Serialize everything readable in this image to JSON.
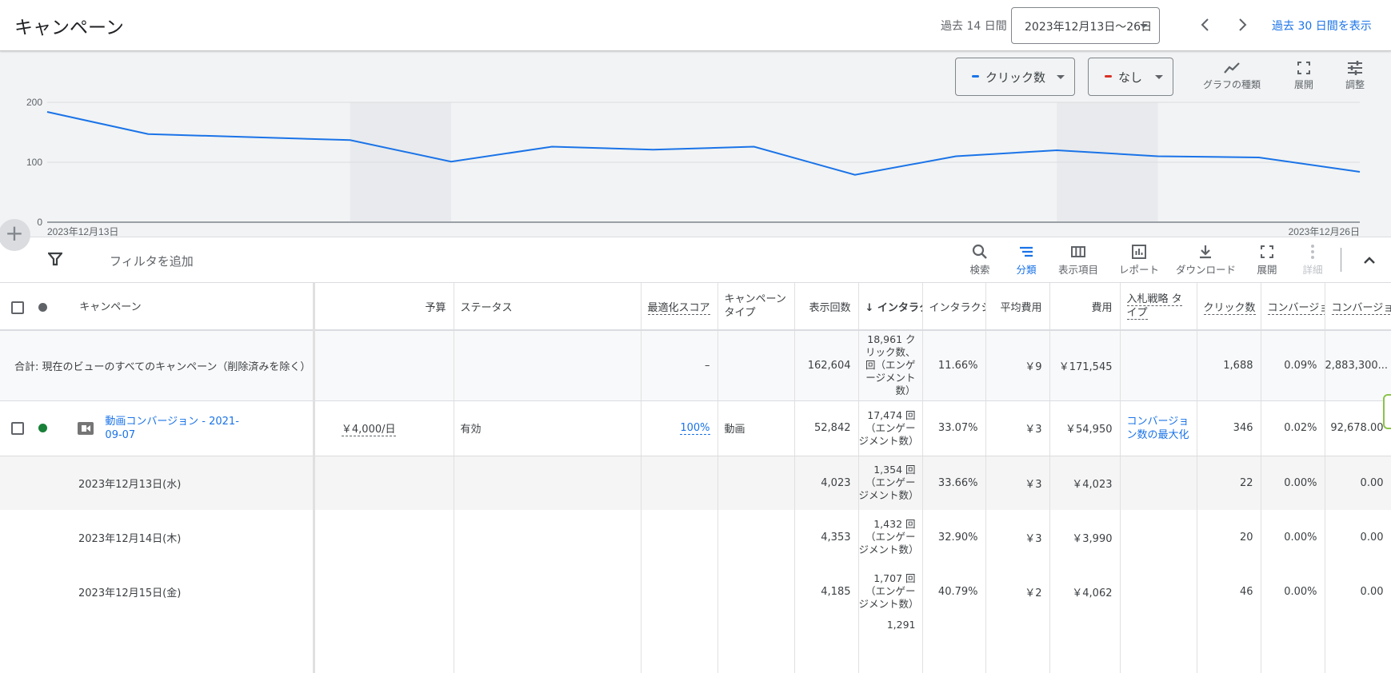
{
  "header": {
    "title": "キャンペーン",
    "range_label": "過去 14 日間",
    "date_range": "2023年12月13日～26日",
    "prev_label": "‹",
    "next_label": "›",
    "show_30_days": "過去 30 日間を表示"
  },
  "chart_controls": {
    "metric1": {
      "label": "クリック数",
      "color": "#1a73e8"
    },
    "metric2": {
      "label": "なし",
      "color": "#d93025"
    },
    "chart_type": "グラフの種類",
    "expand": "展開",
    "adjust": "調整"
  },
  "chart_data": {
    "type": "line",
    "title": "",
    "xlabel": "",
    "ylabel": "",
    "ylim": [
      0,
      200
    ],
    "yticks": [
      "0",
      "100",
      "200"
    ],
    "x_start_label": "2023年12月13日",
    "x_end_label": "2023年12月26日",
    "x": [
      "2023-12-13",
      "2023-12-14",
      "2023-12-15",
      "2023-12-16",
      "2023-12-17",
      "2023-12-18",
      "2023-12-19",
      "2023-12-20",
      "2023-12-21",
      "2023-12-22",
      "2023-12-23",
      "2023-12-24",
      "2023-12-25",
      "2023-12-26"
    ],
    "series": [
      {
        "name": "クリック数",
        "color": "#1a73e8",
        "values": [
          184,
          147,
          142,
          137,
          101,
          126,
          121,
          126,
          79,
          110,
          120,
          110,
          108,
          84
        ]
      }
    ],
    "weekend_bands": [
      [
        3,
        4
      ],
      [
        10,
        11
      ]
    ],
    "grid": true
  },
  "toolbar": {
    "filter_placeholder": "フィルタを追加",
    "buttons": [
      {
        "label": "検索",
        "icon": "search-icon"
      },
      {
        "label": "分類",
        "icon": "segment-icon",
        "active": true
      },
      {
        "label": "表示項目",
        "icon": "columns-icon"
      },
      {
        "label": "レポート",
        "icon": "report-icon"
      },
      {
        "label": "ダウンロード",
        "icon": "download-icon"
      },
      {
        "label": "展開",
        "icon": "fullscreen-icon"
      },
      {
        "label": "詳細",
        "icon": "more-vert-icon",
        "disabled": true
      }
    ]
  },
  "table": {
    "headers": {
      "campaign": "キャンペーン",
      "budget": "予算",
      "status": "ステータス",
      "opt_score": "最適化スコア",
      "campaign_type": "キャンペーン タイプ",
      "impressions": "表示回数",
      "interactions": "インタラクション",
      "interaction_rate": "インタラクション率",
      "avg_cost": "平均費用",
      "cost": "費用",
      "bid_strategy": "入札戦略 タイプ",
      "clicks": "クリック数",
      "conv_rate": "コンバージョン率",
      "conv_value": "コンバージョン値"
    },
    "total": {
      "label": "合計: 現在のビューのすべてのキャンペーン（削除済みを除く）",
      "opt_score": "–",
      "impressions": "162,604",
      "interactions": "18,961 クリック数、回（エンゲージメント数）",
      "interaction_rate": "11.66%",
      "avg_cost": "￥9",
      "cost": "￥171,545",
      "clicks": "1,688",
      "conv_rate": "0.09%",
      "conv_value": "2,883,300..."
    },
    "campaign": {
      "name": "動画コンバージョン - 2021-09-07",
      "status_color": "#188038",
      "budget": "￥4,000/日",
      "status": "有効",
      "opt_score": "100%",
      "campaign_type": "動画",
      "impressions": "52,842",
      "interactions": "17,474 回（エンゲージメント数）",
      "interaction_rate": "33.07%",
      "avg_cost": "￥3",
      "cost": "￥54,950",
      "bid_strategy": "コンバージョン数の最大化",
      "clicks": "346",
      "conv_rate": "0.02%",
      "conv_value": "92,678.00"
    },
    "days": [
      {
        "date": "2023年12月13日(水)",
        "impressions": "4,023",
        "interactions": "1,354 回（エンゲージメント数）",
        "interaction_rate": "33.66%",
        "avg_cost": "￥3",
        "cost": "￥4,023",
        "clicks": "22",
        "conv_rate": "0.00%",
        "conv_value": "0.00"
      },
      {
        "date": "2023年12月14日(木)",
        "impressions": "4,353",
        "interactions": "1,432 回（エンゲージメント数）",
        "interaction_rate": "32.90%",
        "avg_cost": "￥3",
        "cost": "￥3,990",
        "clicks": "20",
        "conv_rate": "0.00%",
        "conv_value": "0.00"
      },
      {
        "date": "2023年12月15日(金)",
        "impressions": "4,185",
        "interactions": "1,707 回（エンゲージメント数）",
        "interaction_rate": "40.79%",
        "avg_cost": "￥2",
        "cost": "￥4,062",
        "clicks": "46",
        "conv_rate": "0.00%",
        "conv_value": "0.00"
      },
      {
        "date": "",
        "impressions": "",
        "interactions": "1,291",
        "interaction_rate": "",
        "avg_cost": "",
        "cost": "",
        "clicks": "",
        "conv_rate": "",
        "conv_value": ""
      }
    ]
  }
}
